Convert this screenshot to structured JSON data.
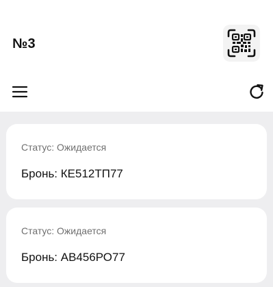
{
  "header": {
    "title": "№3",
    "qr_icon": "qr-code-scan-icon"
  },
  "toolbar": {
    "menu_icon": "hamburger-menu-icon",
    "refresh_icon": "refresh-icon"
  },
  "bookings": [
    {
      "status": "Статус: Ожидается",
      "booking": "Бронь: КЕ512ТП77"
    },
    {
      "status": "Статус: Ожидается",
      "booking": "Бронь: АВ456РО77"
    }
  ],
  "colors": {
    "background": "#ffffff",
    "content_background": "#eeeef0",
    "card_background": "#ffffff",
    "status_text": "#6f6f6f",
    "primary_text": "#111111"
  }
}
